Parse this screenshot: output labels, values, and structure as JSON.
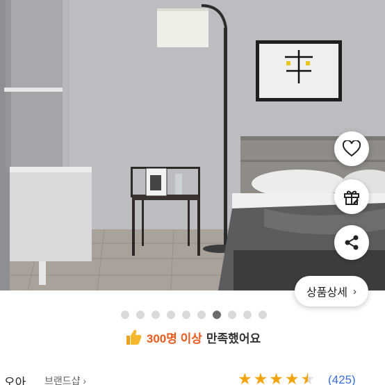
{
  "hero": {
    "image_description_icon": "bedroom-photo",
    "actions": {
      "wishlist_icon": "heart-icon",
      "gift_icon": "gift-icon",
      "share_icon": "share-icon"
    },
    "detail_button": {
      "label": "상품상세",
      "chevron": "›"
    }
  },
  "carousel": {
    "total": 10,
    "active_index": 6
  },
  "satisfaction": {
    "icon": "thumbs-up-icon",
    "highlight": "300명 이상",
    "rest": "만족했어요"
  },
  "seller": {
    "brand": "오아",
    "shop_link": "브랜드샵",
    "shop_chevron": "›"
  },
  "rating": {
    "value": 4.5,
    "max": 5,
    "review_count": "(425)",
    "star_color": "#f2a40c"
  },
  "colors": {
    "accent": "#e85b1c",
    "link": "#3a6fd8"
  }
}
